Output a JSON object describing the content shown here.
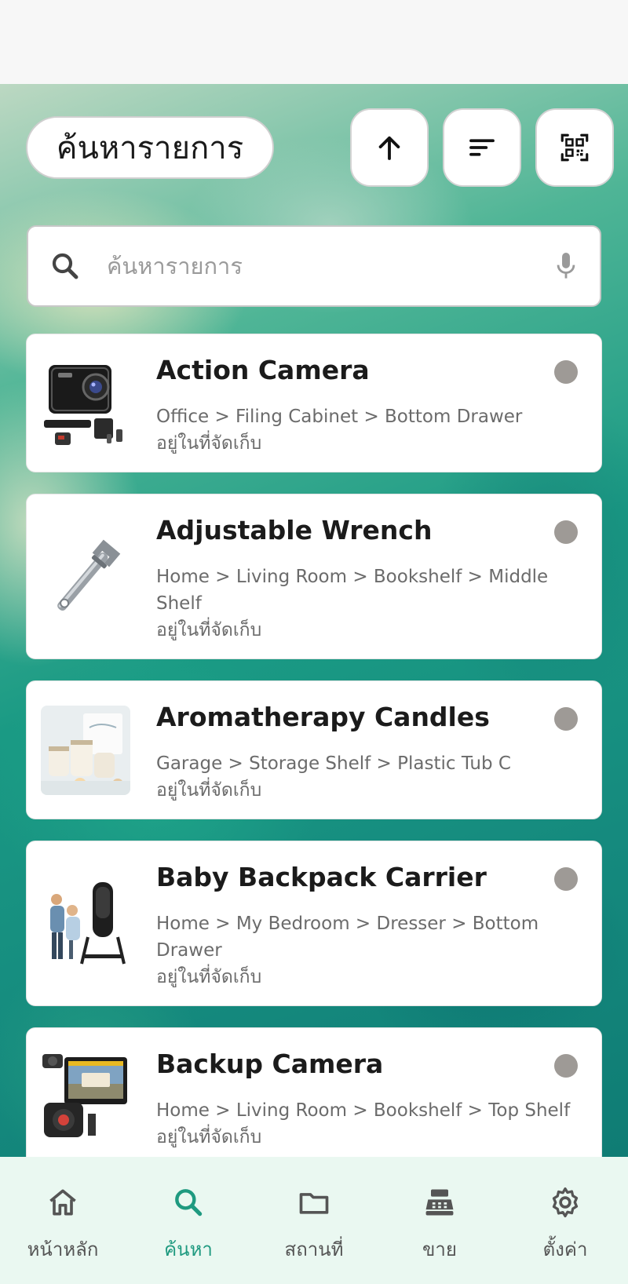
{
  "header": {
    "title": "ค้นหารายการ",
    "buttons": {
      "sort_direction": "arrow-up-icon",
      "sort": "sort-icon",
      "scan": "qr-scan-icon"
    }
  },
  "search": {
    "placeholder": "ค้นหารายการ",
    "value": ""
  },
  "items": [
    {
      "name": "Action Camera",
      "path": "Office > Filing Cabinet > Bottom Drawer",
      "status": "อยู่ในที่จัดเก็บ",
      "image": "action-camera-image"
    },
    {
      "name": "Adjustable Wrench",
      "path": "Home > Living Room > Bookshelf > Middle Shelf",
      "status": "อยู่ในที่จัดเก็บ",
      "image": "wrench-image"
    },
    {
      "name": "Aromatherapy Candles",
      "path": "Garage > Storage Shelf > Plastic Tub C",
      "status": "อยู่ในที่จัดเก็บ",
      "image": "candles-image"
    },
    {
      "name": "Baby Backpack Carrier",
      "path": "Home > My Bedroom > Dresser > Bottom Drawer",
      "status": "อยู่ในที่จัดเก็บ",
      "image": "baby-carrier-image"
    },
    {
      "name": "Backup Camera",
      "path": "Home > Living Room > Bookshelf > Top Shelf",
      "status": "อยู่ในที่จัดเก็บ",
      "image": "backup-camera-image"
    }
  ],
  "colors": {
    "accent": "#1f9a80",
    "status_dot": "#9e9a96",
    "nav_background": "#eaf8f1"
  },
  "nav": [
    {
      "label": "หน้าหลัก",
      "icon": "home-icon",
      "active": false
    },
    {
      "label": "ค้นหา",
      "icon": "search-icon",
      "active": true
    },
    {
      "label": "สถานที่",
      "icon": "folder-icon",
      "active": false
    },
    {
      "label": "ขาย",
      "icon": "cash-register-icon",
      "active": false
    },
    {
      "label": "ตั้งค่า",
      "icon": "gear-icon",
      "active": false
    }
  ]
}
